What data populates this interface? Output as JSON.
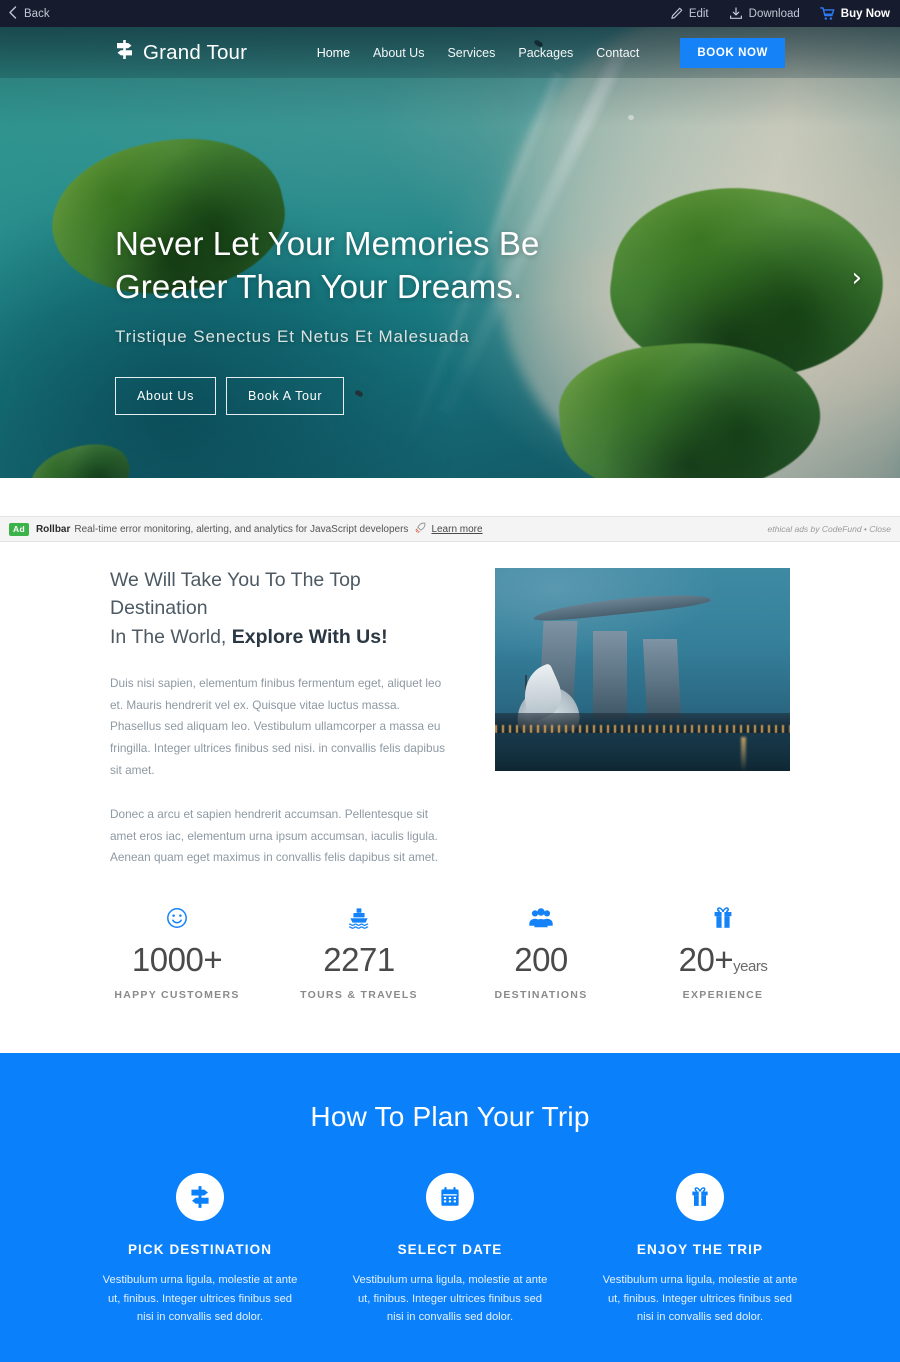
{
  "chrome": {
    "back_label": "Back",
    "edit_label": "Edit",
    "download_label": "Download",
    "buy_label": "Buy Now"
  },
  "nav": {
    "brand": "Grand Tour",
    "links": [
      {
        "label": "Home",
        "active": true
      },
      {
        "label": "About Us",
        "active": false
      },
      {
        "label": "Services",
        "active": false
      },
      {
        "label": "Packages",
        "active": false
      },
      {
        "label": "Contact",
        "active": false
      }
    ],
    "cta": "BOOK NOW"
  },
  "hero": {
    "title_line1": "Never Let Your Memories Be",
    "title_line2": "Greater Than Your Dreams.",
    "subtitle": "Tristique Senectus Et Netus Et Malesuada",
    "button_primary": "About Us",
    "button_secondary": "Book A Tour",
    "next_arrow": "›"
  },
  "ad": {
    "badge": "Ad",
    "brand": "Rollbar",
    "text": "Real-time error monitoring, alerting, and analytics for JavaScript developers",
    "learn_more": "Learn more",
    "attribution": "ethical ads by CodeFund • Close"
  },
  "about": {
    "heading_normal_1": "We Will Take You To The Top Destination",
    "heading_normal_2": "In The World,",
    "heading_bold": "Explore With Us!",
    "paragraph1": "Duis nisi sapien, elementum finibus fermentum eget, aliquet leo et. Mauris hendrerit vel ex. Quisque vitae luctus massa. Phasellus sed aliquam leo. Vestibulum ullamcorper a massa eu fringilla. Integer ultrices finibus sed nisi. in convallis felis dapibus sit amet.",
    "paragraph2": "Donec a arcu et sapien hendrerit accumsan. Pellentesque sit amet eros iac, elementum urna ipsum accumsan, iaculis ligula. Aenean quam eget maximus in convallis felis dapibus sit amet."
  },
  "stats": [
    {
      "icon": "smiley-icon",
      "number": "1000+",
      "suffix": "",
      "label": "HAPPY CUSTOMERS"
    },
    {
      "icon": "ship-icon",
      "number": "2271",
      "suffix": "",
      "label": "TOURS & TRAVELS"
    },
    {
      "icon": "people-icon",
      "number": "200",
      "suffix": "",
      "label": "DESTINATIONS"
    },
    {
      "icon": "gift-icon",
      "number": "20+",
      "suffix": "years",
      "label": "EXPERIENCE"
    }
  ],
  "plan": {
    "title": "How To Plan Your Trip",
    "cards": [
      {
        "icon": "signpost-icon",
        "heading": "PICK DESTINATION",
        "text": "Vestibulum urna ligula, molestie at ante ut, finibus. Integer ultrices finibus sed nisi in convallis sed dolor."
      },
      {
        "icon": "calendar-icon",
        "heading": "SELECT DATE",
        "text": "Vestibulum urna ligula, molestie at ante ut, finibus. Integer ultrices finibus sed nisi in convallis sed dolor."
      },
      {
        "icon": "gift-icon",
        "heading": "ENJOY THE TRIP",
        "text": "Vestibulum urna ligula, molestie at ante ut, finibus. Integer ultrices finibus sed nisi in convallis sed dolor."
      }
    ]
  },
  "colors": {
    "accent_blue": "#0b80fb",
    "nav_button_blue": "#1583f7",
    "chrome_bg": "#161b2e",
    "ad_badge_green": "#3cb34a"
  }
}
